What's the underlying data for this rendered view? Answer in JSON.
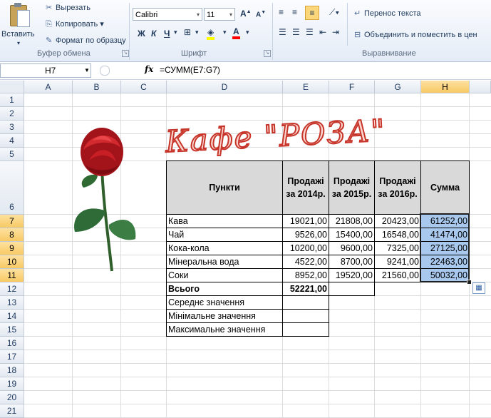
{
  "ribbon": {
    "paste_label": "Вставить",
    "cut_label": "Вырезать",
    "copy_label": "Копировать",
    "format_painter_label": "Формат по образцу",
    "clipboard_group": "Буфер обмена",
    "font_name": "Calibri",
    "font_size": "11",
    "font_group": "Шрифт",
    "wrap_text_label": "Перенос текста",
    "merge_label": "Объединить и поместить в цен",
    "alignment_group": "Выравнивание",
    "bold": "Ж",
    "italic": "К",
    "underline": "Ч"
  },
  "formula_bar": {
    "name_box": "H7",
    "fx": "fx",
    "formula": "=СУММ(E7:G7)"
  },
  "columns": [
    "A",
    "B",
    "C",
    "D",
    "E",
    "F",
    "G",
    "H"
  ],
  "rows": [
    "1",
    "2",
    "3",
    "4",
    "5",
    "6",
    "7",
    "8",
    "9",
    "10",
    "11",
    "12",
    "13",
    "14",
    "15",
    "16",
    "17",
    "18",
    "19",
    "20",
    "21"
  ],
  "title": "Кафе \"РОЗА\"",
  "table": {
    "headers": [
      "Пункти",
      "Продажі за 2014р.",
      "Продажі за 2015р.",
      "Продажі за 2016р.",
      "Сумма"
    ],
    "rows": [
      [
        "Кава",
        "19021,00",
        "21808,00",
        "20423,00",
        "61252,00"
      ],
      [
        "Чай",
        "9526,00",
        "15400,00",
        "16548,00",
        "41474,00"
      ],
      [
        "Кока-кола",
        "10200,00",
        "9600,00",
        "7325,00",
        "27125,00"
      ],
      [
        "Мінеральна вода",
        "4522,00",
        "8700,00",
        "9241,00",
        "22463,00"
      ],
      [
        "Соки",
        "8952,00",
        "19520,00",
        "21560,00",
        "50032,00"
      ]
    ],
    "total_label": "Всього",
    "total_value": "52221,00",
    "avg_label": "Середнє значення",
    "min_label": "Мінімальне значення",
    "max_label": "Максимальне значення"
  },
  "colors": {
    "selection": "#a9c8ee",
    "header_fill": "#d9d9d9",
    "title_stroke": "#c7352a"
  }
}
